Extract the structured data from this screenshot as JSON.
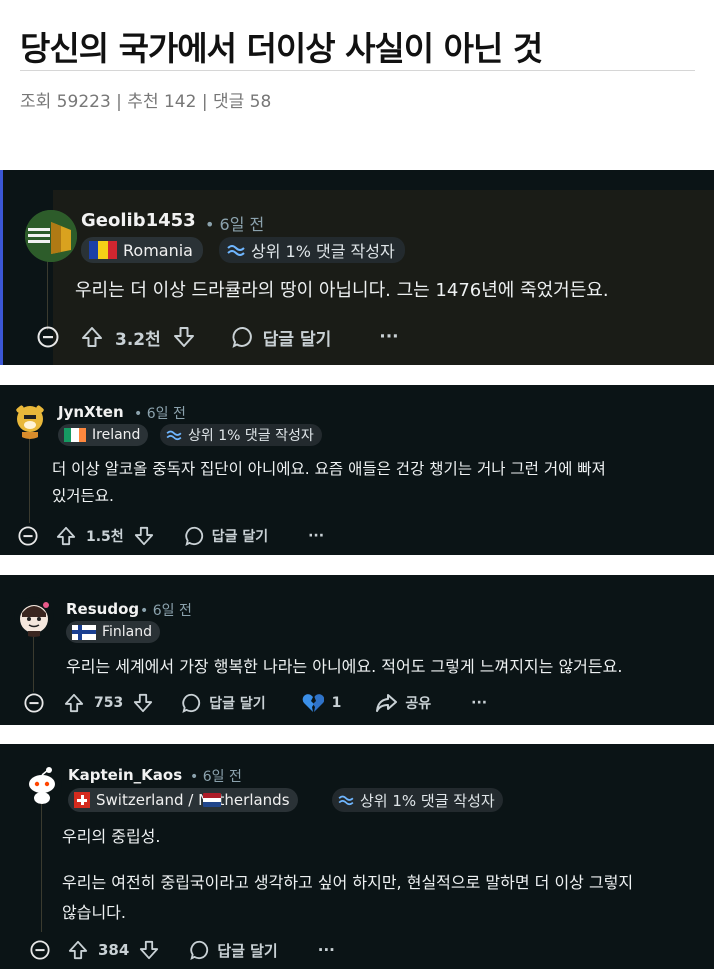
{
  "post": {
    "title": "당신의 국가에서 더이상 사실이 아닌 것",
    "meta": "조회 59223 | 추천 142 | 댓글 58"
  },
  "colors": {
    "card_bg": "#0b1416",
    "highlight_bg": "#1a1c17",
    "accent_border": "#3b57d6",
    "flair_bg": "#2a3236"
  },
  "comments": [
    {
      "username": "Geolib1453",
      "age": "• 6일 전",
      "flair": "Romania",
      "badge": "상위 1% 댓글 작성자",
      "text": "우리는 더 이상 드라큘라의 땅이 아닙니다. 그는 1476년에 죽었거든요.",
      "upvotes": "3.2천",
      "reply": "답글 달기",
      "more": "···"
    },
    {
      "username": "JynXten",
      "age": "• 6일 전",
      "flair": "Ireland",
      "badge": "상위 1% 댓글 작성자",
      "text_line1": "더 이상 알코올 중독자 집단이 아니에요. 요즘 애들은 건강 챙기는 거나 그런 거에 빠져",
      "text_line2": "있거든요.",
      "upvotes": "1.5천",
      "reply": "답글 달기",
      "more": "···"
    },
    {
      "username": "Resudog",
      "age": "• 6일 전",
      "flair": "Finland",
      "text": "우리는 세계에서 가장 행복한 나라는 아니에요. 적어도 그렇게 느껴지지는 않거든요.",
      "upvotes": "753",
      "reply": "답글 달기",
      "awards": "1",
      "share": "공유",
      "more": "···"
    },
    {
      "username": "Kaptein_Kaos",
      "age": "• 6일 전",
      "flair": "Switzerland / Netherlands",
      "badge": "상위 1% 댓글 작성자",
      "text_line1": "우리의 중립성.",
      "text_line2": "우리는 여전히 중립국이라고 생각하고 싶어 하지만, 현실적으로 말하면 더 이상 그렇지",
      "text_line3": "않습니다.",
      "upvotes": "384",
      "reply": "답글 달기",
      "more": "···"
    }
  ]
}
